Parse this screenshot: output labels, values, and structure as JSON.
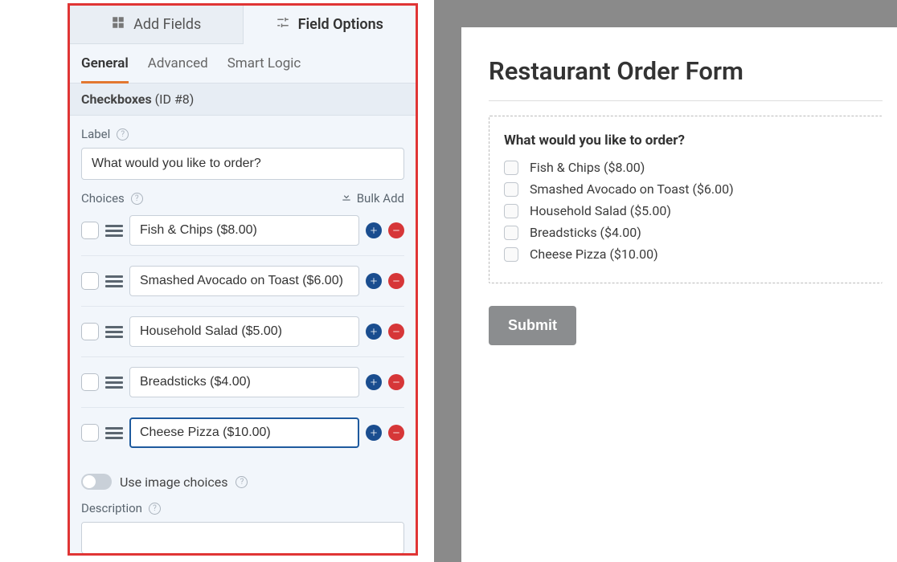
{
  "topTabs": {
    "addFields": "Add Fields",
    "fieldOptions": "Field Options"
  },
  "subTabs": {
    "general": "General",
    "advanced": "Advanced",
    "smartLogic": "Smart Logic"
  },
  "fieldHeader": {
    "type": "Checkboxes",
    "idText": "(ID #8)"
  },
  "labels": {
    "label": "Label",
    "choices": "Choices",
    "bulkAdd": "Bulk Add",
    "useImageChoices": "Use image choices",
    "description": "Description"
  },
  "labelValue": "What would you like to order?",
  "choices": [
    {
      "text": "Fish & Chips ($8.00)",
      "focused": false
    },
    {
      "text": "Smashed Avocado on Toast ($6.00)",
      "focused": false
    },
    {
      "text": "Household Salad ($5.00)",
      "focused": false
    },
    {
      "text": "Breadsticks ($4.00)",
      "focused": false
    },
    {
      "text": "Cheese Pizza ($10.00)",
      "focused": true
    }
  ],
  "preview": {
    "title": "Restaurant Order Form",
    "question": "What would you like to order?",
    "options": [
      "Fish & Chips ($8.00)",
      "Smashed Avocado on Toast ($6.00)",
      "Household Salad ($5.00)",
      "Breadsticks ($4.00)",
      "Cheese Pizza ($10.00)"
    ],
    "submit": "Submit"
  }
}
